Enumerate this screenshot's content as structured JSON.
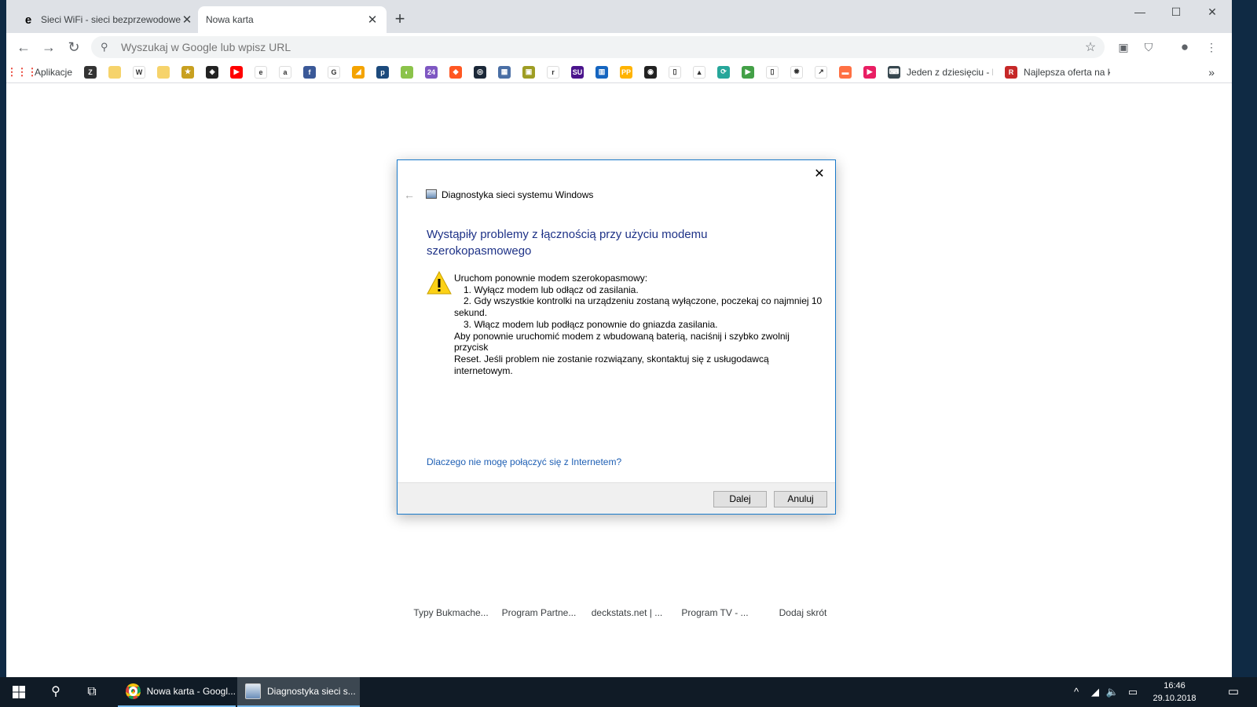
{
  "browser": {
    "tabs": [
      {
        "title": "Sieci WiFi - sieci bezprzewodowe",
        "favicon": "ie-e-icon",
        "active": false
      },
      {
        "title": "Nowa karta",
        "favicon": "",
        "active": true
      }
    ],
    "new_tab_symbol": "+",
    "window_controls": {
      "minimize": "—",
      "maximize": "☐",
      "close": "✕"
    },
    "omnibox": {
      "placeholder": "Wyszukaj w Google lub wpisz URL"
    },
    "bookmarks": {
      "apps_label": "Aplikacje",
      "items": [
        {
          "label": "",
          "icon": "bookmark-icon",
          "color": "#333333",
          "glyph": "Z"
        },
        {
          "label": "",
          "icon": "folder-icon",
          "color": "#f6d36b",
          "glyph": ""
        },
        {
          "label": "",
          "icon": "wp-icon",
          "color": "#ffffff",
          "glyph": "W"
        },
        {
          "label": "",
          "icon": "folder-icon",
          "color": "#f6d36b",
          "glyph": ""
        },
        {
          "label": "",
          "icon": "bookmark-icon",
          "color": "#c8a020",
          "glyph": "★"
        },
        {
          "label": "",
          "icon": "bookmark-icon",
          "color": "#222222",
          "glyph": "◈"
        },
        {
          "label": "",
          "icon": "youtube-icon",
          "color": "#ff0000",
          "glyph": "▶"
        },
        {
          "label": "",
          "icon": "ie-icon",
          "color": "#ffffff",
          "glyph": "e"
        },
        {
          "label": "",
          "icon": "amazon-icon",
          "color": "#ffffff",
          "glyph": "a"
        },
        {
          "label": "",
          "icon": "facebook-icon",
          "color": "#3b5998",
          "glyph": "f"
        },
        {
          "label": "",
          "icon": "google-icon",
          "color": "#ffffff",
          "glyph": "G"
        },
        {
          "label": "",
          "icon": "bookmark-icon",
          "color": "#f4a300",
          "glyph": "◢"
        },
        {
          "label": "",
          "icon": "bookmark-icon",
          "color": "#1c4a7c",
          "glyph": "p"
        },
        {
          "label": "",
          "icon": "bookmark-icon",
          "color": "#8bc34a",
          "glyph": "◐"
        },
        {
          "label": "",
          "icon": "bookmark-icon",
          "color": "#7e57c2",
          "glyph": "24"
        },
        {
          "label": "",
          "icon": "bookmark-icon",
          "color": "#ff5722",
          "glyph": "◆"
        },
        {
          "label": "",
          "icon": "steam-icon",
          "color": "#1b2838",
          "glyph": "◎"
        },
        {
          "label": "",
          "icon": "bookmark-icon",
          "color": "#4a6fa5",
          "glyph": "▦"
        },
        {
          "label": "",
          "icon": "bookmark-icon",
          "color": "#9e9d24",
          "glyph": "▣"
        },
        {
          "label": "",
          "icon": "bookmark-icon",
          "color": "#ffffff",
          "glyph": "r"
        },
        {
          "label": "",
          "icon": "bookmark-icon",
          "color": "#4a148c",
          "glyph": "SU"
        },
        {
          "label": "",
          "icon": "bookmark-icon",
          "color": "#1565c0",
          "glyph": "▥"
        },
        {
          "label": "",
          "icon": "bookmark-icon",
          "color": "#ffb300",
          "glyph": "PP"
        },
        {
          "label": "",
          "icon": "bookmark-icon",
          "color": "#212121",
          "glyph": "◉"
        },
        {
          "label": "",
          "icon": "page-icon",
          "color": "#ffffff",
          "glyph": "▯"
        },
        {
          "label": "",
          "icon": "flame-icon",
          "color": "#ffffff",
          "glyph": "▲"
        },
        {
          "label": "",
          "icon": "bookmark-icon",
          "color": "#26a69a",
          "glyph": "⟳"
        },
        {
          "label": "",
          "icon": "play-icon",
          "color": "#43a047",
          "glyph": "▶"
        },
        {
          "label": "",
          "icon": "page-icon",
          "color": "#ffffff",
          "glyph": "▯"
        },
        {
          "label": "",
          "icon": "bug-icon",
          "color": "#ffffff",
          "glyph": "✹"
        },
        {
          "label": "",
          "icon": "chart-icon",
          "color": "#ffffff",
          "glyph": "↗"
        },
        {
          "label": "",
          "icon": "bookmark-icon",
          "color": "#ff7043",
          "glyph": "▬"
        },
        {
          "label": "",
          "icon": "bookmark-icon",
          "color": "#e91e63",
          "glyph": "▶"
        },
        {
          "label": "Jeden z dziesięciu - N",
          "icon": "keyboard-icon",
          "color": "#37474f",
          "glyph": "⌨"
        },
        {
          "label": "Najlepsza oferta na k",
          "icon": "bookmark-icon",
          "color": "#c62828",
          "glyph": "R"
        }
      ],
      "more": "»"
    },
    "tiles": [
      "Typy Bukmache...",
      "Program Partne...",
      "deckstats.net | ...",
      "Program TV - ...",
      "Dodaj skrót"
    ]
  },
  "dialog": {
    "app_title": "Diagnostyka sieci systemu Windows",
    "heading": "Wystąpiły problemy z łącznością przy użyciu modemu szerokopasmowego",
    "body": {
      "line1": "Uruchom ponownie modem szerokopasmowy:",
      "step1": "1.  Wyłącz modem lub odłącz od zasilania.",
      "step2a": "2.  Gdy wszystkie kontrolki na urządzeniu zostaną wyłączone, poczekaj co najmniej 10",
      "step2b": "sekund.",
      "step3": "3.  Włącz modem lub podłącz ponownie do gniazda zasilania.",
      "line5": "Aby ponownie uruchomić modem z wbudowaną baterią, naciśnij i szybko zwolnij przycisk",
      "line6": "Reset. Jeśli problem nie zostanie rozwiązany, skontaktuj się z usługodawcą internetowym."
    },
    "link": "Dlaczego nie mogę połączyć się z Internetem?",
    "buttons": {
      "next": "Dalej",
      "cancel": "Anuluj"
    },
    "close": "✕"
  },
  "taskbar": {
    "apps": [
      {
        "label": "Nowa karta - Googl...",
        "icon": "chrome-icon"
      },
      {
        "label": "Diagnostyka sieci s...",
        "icon": "network-diagnostics-icon"
      }
    ],
    "tray": {
      "chevron": "^",
      "wifi": "wifi-icon",
      "volume": "🔈",
      "battery": "battery-icon"
    },
    "clock": {
      "time": "16:46",
      "date": "29.10.2018"
    },
    "notification": "notification-icon"
  }
}
